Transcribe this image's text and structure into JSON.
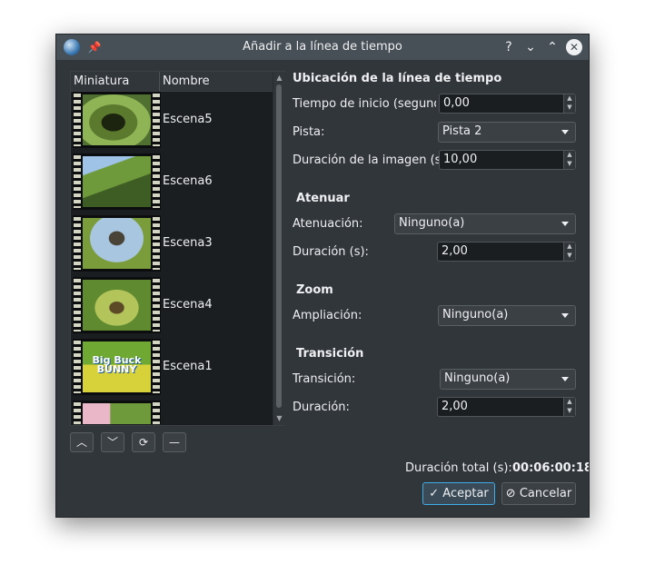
{
  "window": {
    "title": "Añadir a la línea de tiempo",
    "help_label": "?",
    "minimize_label": "⌄",
    "maximize_label": "⌃",
    "close_label": "✕"
  },
  "list": {
    "columns": [
      "Miniatura",
      "Nombre"
    ],
    "items": [
      {
        "name": "Escena5"
      },
      {
        "name": "Escena6"
      },
      {
        "name": "Escena3"
      },
      {
        "name": "Escena4"
      },
      {
        "name": "Escena1"
      },
      {
        "name": ""
      }
    ],
    "thumbnail_text": "Big Buck BUNNY"
  },
  "list_buttons": {
    "up": "︿",
    "down": "﹀",
    "refresh": "⟳",
    "remove": "—"
  },
  "placement": {
    "heading": "Ubicación de la línea de tiempo",
    "start_label": "Tiempo de inicio (segundos)",
    "start_value": "0,00",
    "track_label": "Pista:",
    "track_value": "Pista 2",
    "image_duration_label": "Duración de la imagen (s)",
    "image_duration_value": "10,00"
  },
  "fade": {
    "heading": "Atenuar",
    "fade_label": "Atenuación:",
    "fade_value": "Ninguno(a)",
    "duration_label": "Duración (s):",
    "duration_value": "2,00"
  },
  "zoom": {
    "heading": "Zoom",
    "zoom_label": "Ampliación:",
    "zoom_value": "Ninguno(a)"
  },
  "transition": {
    "heading": "Transición",
    "transition_label": "Transición:",
    "transition_value": "Ninguno(a)",
    "duration_label": "Duración:",
    "duration_value": "2,00"
  },
  "total": {
    "label": "Duración total (s):",
    "value": "00:06:00:18"
  },
  "buttons": {
    "accept": "Aceptar",
    "cancel": "Cancelar"
  }
}
